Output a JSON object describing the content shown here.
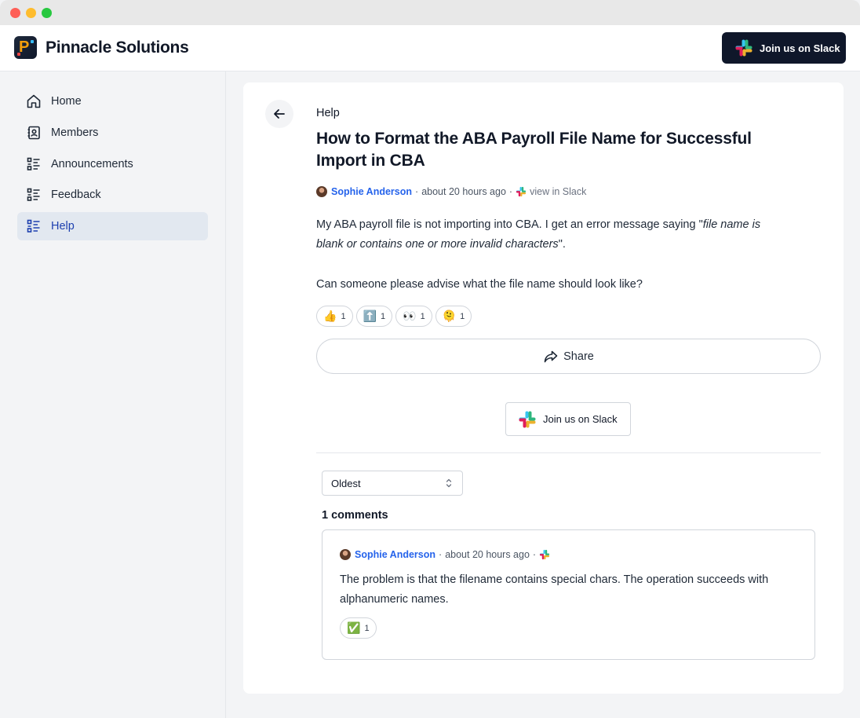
{
  "app": {
    "brand": "Pinnacle Solutions",
    "slack_cta": "Join us on Slack"
  },
  "sidebar": {
    "items": [
      {
        "label": "Home",
        "icon": "home-icon"
      },
      {
        "label": "Members",
        "icon": "contacts-icon"
      },
      {
        "label": "Announcements",
        "icon": "list-icon"
      },
      {
        "label": "Feedback",
        "icon": "list-icon"
      },
      {
        "label": "Help",
        "icon": "list-icon",
        "active": true
      }
    ]
  },
  "post": {
    "category": "Help",
    "title": "How to Format the ABA Payroll File Name for Successful Import in CBA",
    "author": "Sophie Anderson",
    "time": "about 20 hours ago",
    "view_in_slack": "view in Slack",
    "body_intro": "My ABA payroll file is not importing into CBA. I get an error message saying \"",
    "body_quote": "file name is blank or contains one or more invalid characters",
    "body_outro": "\".",
    "body_question": "Can someone please advise what the file name should look like?",
    "reactions": [
      {
        "emoji": "👍",
        "count": "1"
      },
      {
        "emoji": "⬆️",
        "count": "1"
      },
      {
        "emoji": "👀",
        "count": "1"
      },
      {
        "emoji": "🫠",
        "count": "1"
      }
    ],
    "share_label": "Share",
    "slack_cta": "Join us on Slack"
  },
  "comments": {
    "sort_selected": "Oldest",
    "count_label": "1 comments",
    "items": [
      {
        "author": "Sophie Anderson",
        "time": "about 20 hours ago",
        "text": "The problem is that the filename contains special chars. The operation succeeds with alphanumeric names.",
        "reactions": [
          {
            "emoji": "✅",
            "count": "1"
          }
        ]
      }
    ]
  },
  "colors": {
    "accent": "#2563eb",
    "active_nav_bg": "#e2e8f0",
    "active_nav_text": "#1e40af",
    "dark_button": "#0f172a"
  }
}
